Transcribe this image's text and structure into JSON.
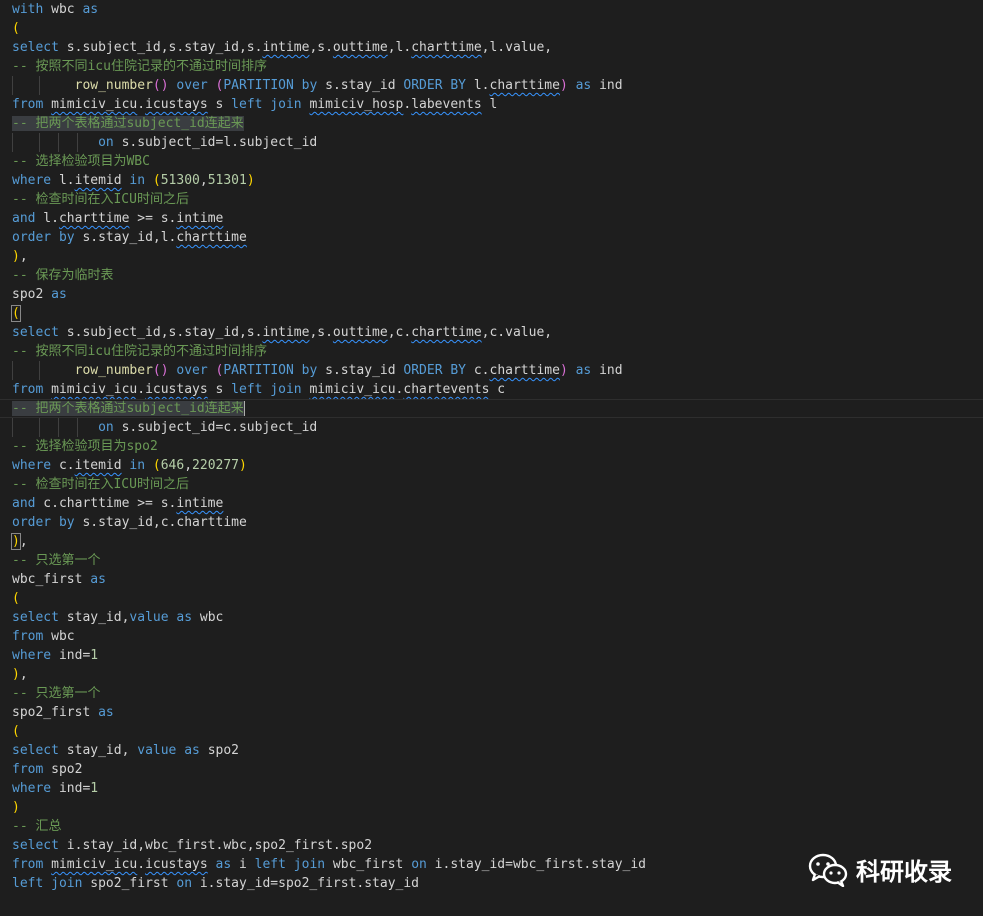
{
  "editor": {
    "theme": "dark",
    "colors": {
      "background": "#1e1e1e",
      "keyword": "#569cd6",
      "comment": "#6a9955",
      "function": "#dcdcaa",
      "number": "#b5cea8",
      "paren": "#ffd700"
    },
    "lines": [
      "with wbc as",
      "(",
      "select s.subject_id,s.stay_id,s.intime,s.outtime,l.charttime,l.value,",
      "-- 按照不同icu住院记录的不通过时间排序",
      "row_number() over (PARTITION by s.stay_id ORDER BY l.charttime) as ind",
      "from mimiciv_icu.icustays s left join mimiciv_hosp.labevents l",
      "-- 把两个表格通过subject_id连起来",
      "on s.subject_id=l.subject_id",
      "-- 选择检验项目为WBC",
      "where l.itemid in (51300,51301)",
      "-- 检查时间在入ICU时间之后",
      "and l.charttime >= s.intime",
      "order by s.stay_id,l.charttime",
      "),",
      "-- 保存为临时表",
      "spo2 as",
      "(",
      "select s.subject_id,s.stay_id,s.intime,s.outtime,c.charttime,c.value,",
      "-- 按照不同icu住院记录的不通过时间排序",
      "row_number() over (PARTITION by s.stay_id ORDER BY c.charttime) as ind",
      "from mimiciv_icu.icustays s left join mimiciv_icu.chartevents c",
      "-- 把两个表格通过subject_id连起来",
      "on s.subject_id=c.subject_id",
      "-- 选择检验项目为spo2",
      "where c.itemid in (646,220277)",
      "-- 检查时间在入ICU时间之后",
      "and c.charttime >= s.intime",
      "order by s.stay_id,c.charttime",
      "),",
      "-- 只选第一个",
      "wbc_first as",
      "(",
      "select stay_id,value as wbc",
      "from wbc",
      "where ind=1",
      "),",
      "-- 只选第一个",
      "spo2_first as",
      "(",
      "select stay_id, value as spo2",
      "from spo2",
      "where ind=1",
      ")",
      "-- 汇总",
      "select i.stay_id,wbc_first.wbc,spo2_first.spo2",
      "from mimiciv_icu.icustays as i left join wbc_first on i.stay_id=wbc_first.stay_id",
      "left join spo2_first on i.stay_id=spo2_first.stay_id"
    ]
  },
  "watermark": {
    "icon": "wechat-icon",
    "text": "科研收录"
  }
}
